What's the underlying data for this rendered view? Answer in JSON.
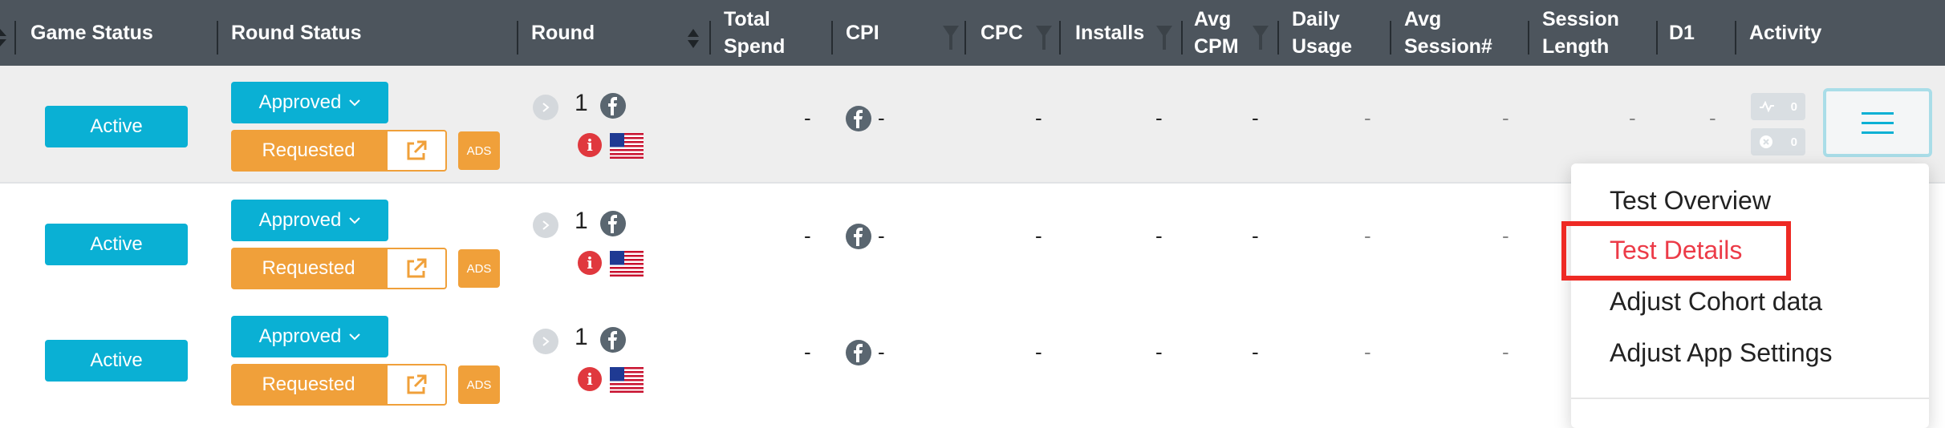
{
  "header": {
    "columns": [
      {
        "key": "game_status",
        "label": "Game Status"
      },
      {
        "key": "round_status",
        "label": "Round Status"
      },
      {
        "key": "round",
        "label": "Round"
      },
      {
        "key": "total_spend",
        "label": "Total\nSpend"
      },
      {
        "key": "cpi",
        "label": "CPI"
      },
      {
        "key": "cpc",
        "label": "CPC"
      },
      {
        "key": "installs",
        "label": "Installs"
      },
      {
        "key": "avg_cpm",
        "label": "Avg\nCPM"
      },
      {
        "key": "daily_usage",
        "label": "Daily\nUsage"
      },
      {
        "key": "avg_session",
        "label": "Avg\nSession#"
      },
      {
        "key": "session_length",
        "label": "Session\nLength"
      },
      {
        "key": "d1",
        "label": "D1"
      },
      {
        "key": "activity",
        "label": "Activity"
      }
    ]
  },
  "rows": [
    {
      "game_status": "Active",
      "round_status": "Approved",
      "requested": "Requested",
      "ads": "ADS",
      "round": "1",
      "info": "i",
      "total_spend": "-",
      "cpi": "-",
      "cpc": "-",
      "installs": "-",
      "avg_cpm": "-",
      "daily_usage": "-",
      "avg_session": "-",
      "session_length": "-",
      "d1": "-",
      "activity_count_1": "0",
      "activity_count_2": "0"
    },
    {
      "game_status": "Active",
      "round_status": "Approved",
      "requested": "Requested",
      "ads": "ADS",
      "round": "1",
      "info": "i",
      "total_spend": "-",
      "cpi": "-",
      "cpc": "-",
      "installs": "-",
      "avg_cpm": "-",
      "daily_usage": "-",
      "avg_session": "-"
    },
    {
      "game_status": "Active",
      "round_status": "Approved",
      "requested": "Requested",
      "ads": "ADS",
      "round": "1",
      "info": "i",
      "total_spend": "-",
      "cpi": "-",
      "cpc": "-",
      "installs": "-",
      "avg_cpm": "-",
      "daily_usage": "-",
      "avg_session": "-"
    }
  ],
  "dropdown": {
    "items": [
      "Test Overview",
      "Test Details",
      "Adjust Cohort data",
      "Adjust App Settings"
    ],
    "selected_index": 1
  },
  "colors": {
    "header_bg": "#4d555d",
    "active": "#0ab0d4",
    "requested": "#f0a03a",
    "highlight": "#ee2a24",
    "selected_text": "#ec3b48"
  }
}
